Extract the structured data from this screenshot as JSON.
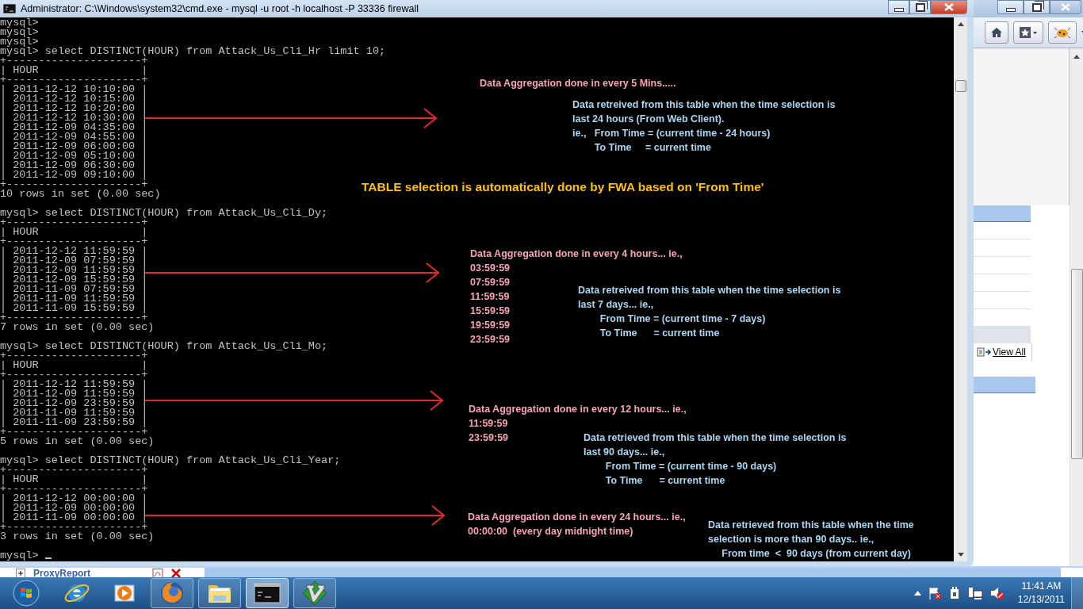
{
  "console_window": {
    "title": "Administrator: C:\\Windows\\system32\\cmd.exe - mysql  -u root -h localhost -P 33336 firewall",
    "output_blocks": [
      [
        "mysql>",
        "mysql>",
        "mysql>",
        "mysql> select DISTINCT(HOUR) from Attack_Us_Cli_Hr limit 10;",
        "+---------------------+",
        "| HOUR                |",
        "+---------------------+",
        "| 2011-12-12 10:10:00 |",
        "| 2011-12-12 10:15:00 |",
        "| 2011-12-12 10:20:00 |",
        "| 2011-12-12 10:30:00 |",
        "| 2011-12-09 04:35:00 |",
        "| 2011-12-09 04:55:00 |",
        "| 2011-12-09 06:00:00 |",
        "| 2011-12-09 05:10:00 |",
        "| 2011-12-09 06:30:00 |",
        "| 2011-12-09 09:10:00 |",
        "+---------------------+",
        "10 rows in set (0.00 sec)"
      ],
      [
        "mysql> select DISTINCT(HOUR) from Attack_Us_Cli_Dy;",
        "+---------------------+",
        "| HOUR                |",
        "+---------------------+",
        "| 2011-12-12 11:59:59 |",
        "| 2011-12-09 07:59:59 |",
        "| 2011-12-09 11:59:59 |",
        "| 2011-12-09 15:59:59 |",
        "| 2011-11-09 07:59:59 |",
        "| 2011-11-09 11:59:59 |",
        "| 2011-11-09 15:59:59 |",
        "+---------------------+",
        "7 rows in set (0.00 sec)"
      ],
      [
        "mysql> select DISTINCT(HOUR) from Attack_Us_Cli_Mo;",
        "+---------------------+",
        "| HOUR                |",
        "+---------------------+",
        "| 2011-12-12 11:59:59 |",
        "| 2011-12-09 11:59:59 |",
        "| 2011-12-09 23:59:59 |",
        "| 2011-11-09 11:59:59 |",
        "| 2011-11-09 23:59:59 |",
        "+---------------------+",
        "5 rows in set (0.00 sec)"
      ],
      [
        "mysql> select DISTINCT(HOUR) from Attack_Us_Cli_Year;",
        "+---------------------+",
        "| HOUR                |",
        "+---------------------+",
        "| 2011-12-12 00:00:00 |",
        "| 2011-12-09 00:00:00 |",
        "| 2011-11-09 00:00:00 |",
        "+---------------------+",
        "3 rows in set (0.00 sec)"
      ],
      [
        "mysql>"
      ]
    ],
    "notes": [
      {
        "color": "#f7a3b3",
        "lines": [
          "Data Aggregation done in every 5 Mins....."
        ]
      },
      {
        "color": "#a9d6f2",
        "lines": [
          "Data retreived from this table when the time selection is",
          "last 24 hours (From Web Client).",
          "ie.,   From Time = (current time - 24 hours)",
          "        To Time     = current time"
        ]
      },
      {
        "color": "#ffc000",
        "lines": [
          "TABLE selection is automatically done by FWA based on 'From Time'"
        ]
      },
      {
        "color": "#f7a3b3",
        "lines": [
          "Data Aggregation done in every 4 hours... ie.,",
          "03:59:59",
          "07:59:59",
          "11:59:59",
          "15:59:59",
          "19:59:59",
          "23:59:59"
        ]
      },
      {
        "color": "#a9d6f2",
        "lines": [
          "Data retreived from this table when the time selection is",
          "last 7 days... ie.,",
          "        From Time = (current time - 7 days)",
          "        To Time      = current time"
        ]
      },
      {
        "color": "#f7a3b3",
        "lines": [
          "Data Aggregation done in every 12 hours... ie.,",
          "11:59:59",
          "23:59:59"
        ]
      },
      {
        "color": "#a9d6f2",
        "lines": [
          "Data retrieved from this table when the time selection is",
          "last 90 days... ie.,",
          "        From Time = (current time - 90 days)",
          "        To Time      = current time"
        ]
      },
      {
        "color": "#f7a3b3",
        "lines": [
          "Data Aggregation done in every 24 hours... ie.,",
          "00:00:00  (every day midnight time)"
        ]
      },
      {
        "color": "#a9d6f2",
        "lines": [
          "Data retrieved from this table when the time",
          "selection is more than 90 days.. ie.,",
          "     From time  <  90 days (from current day)"
        ]
      }
    ]
  },
  "browser_window": {
    "tree_item": "ProxyReport",
    "link": "View All"
  },
  "taskbar": {
    "apps": [
      {
        "kind": "ie",
        "running": false,
        "selected": false
      },
      {
        "kind": "media",
        "running": false,
        "selected": false
      },
      {
        "kind": "firefox",
        "running": true,
        "selected": false
      },
      {
        "kind": "explorer",
        "running": true,
        "selected": false
      },
      {
        "kind": "cmd",
        "running": true,
        "selected": true
      },
      {
        "kind": "vim",
        "running": true,
        "selected": false
      }
    ],
    "time": "11:41 AM",
    "date": "12/13/2011"
  }
}
